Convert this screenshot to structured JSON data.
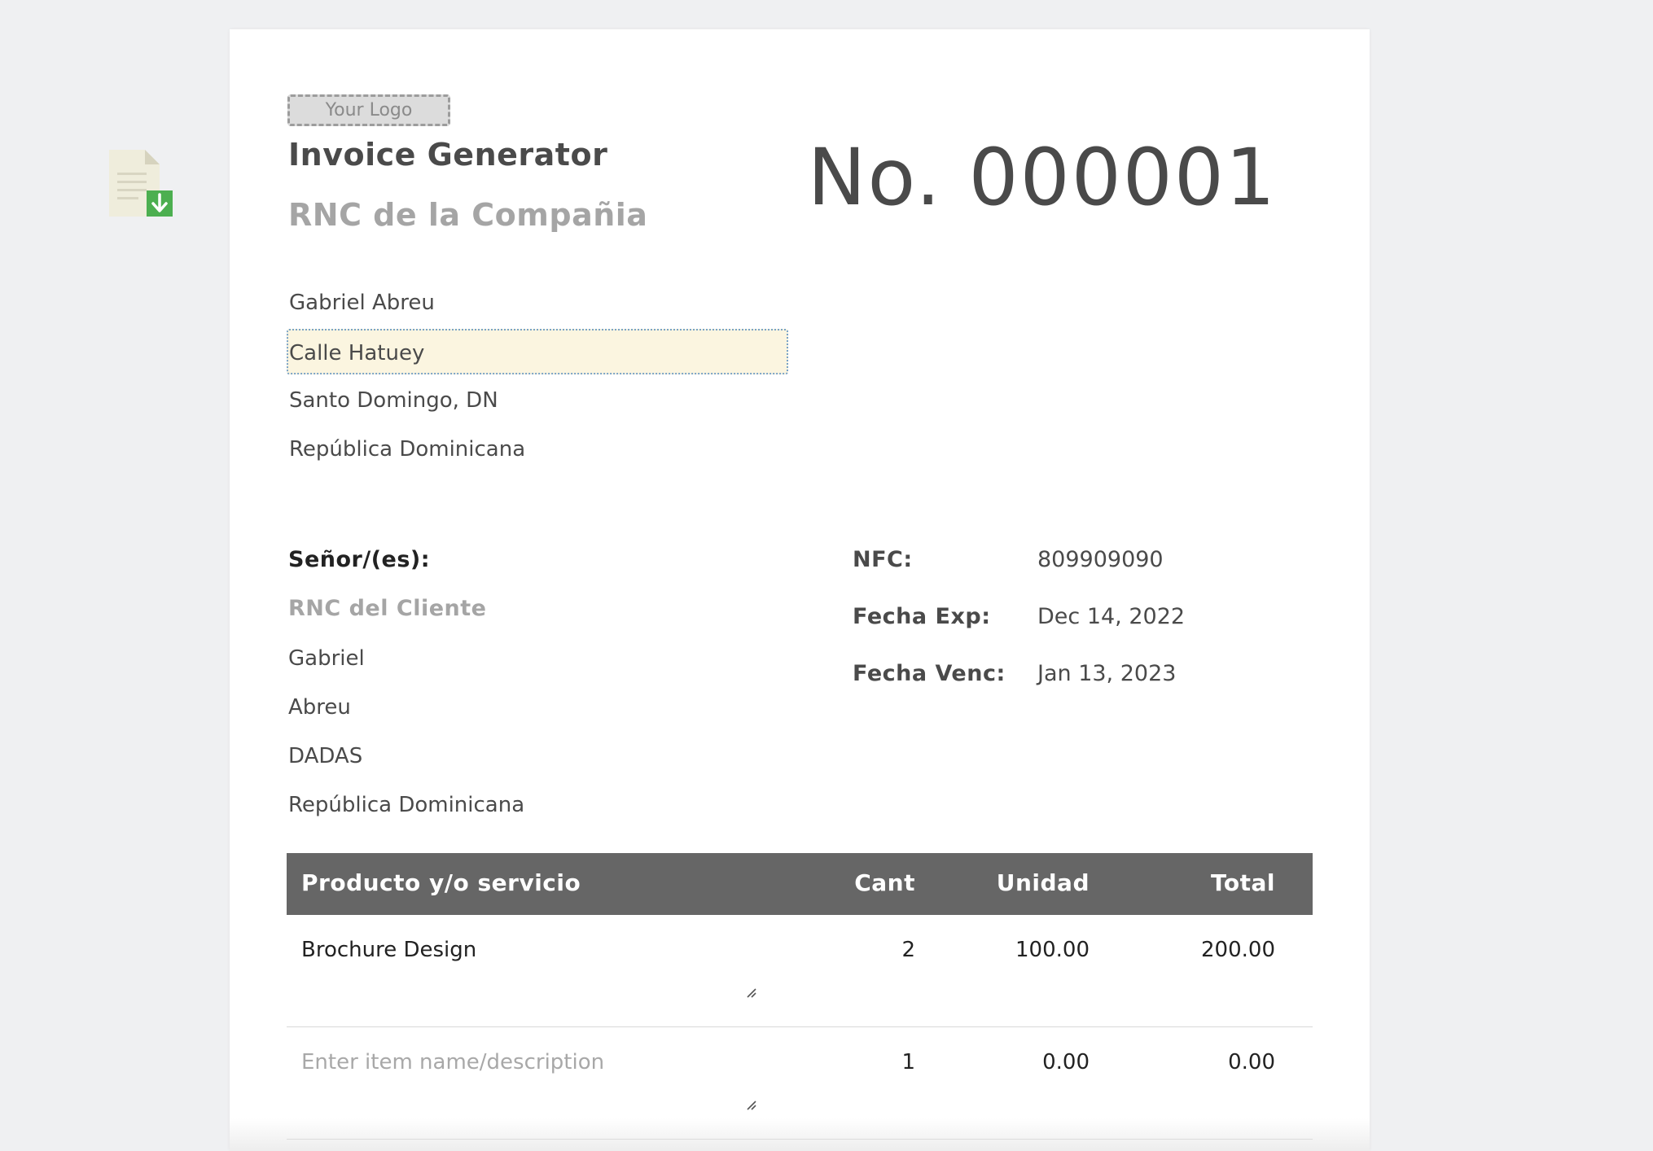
{
  "company": {
    "logo_placeholder": "Your Logo",
    "name": "Invoice Generator",
    "rnc": "RNC de la Compañia",
    "address_lines": [
      "Gabriel Abreu",
      "Calle Hatuey",
      "Santo Domingo, DN",
      "República Dominicana"
    ]
  },
  "invoice": {
    "number": "No. 000001"
  },
  "client": {
    "label": "Señor/(es):",
    "rnc": "RNC del Cliente",
    "lines": [
      "Gabriel",
      "Abreu",
      "DADAS",
      "República Dominicana"
    ]
  },
  "meta": [
    {
      "label": "NFC:",
      "value": "809909090"
    },
    {
      "label": "Fecha Exp:",
      "value": "Dec 14, 2022"
    },
    {
      "label": "Fecha Venc:",
      "value": "Jan 13, 2023"
    }
  ],
  "table": {
    "headers": {
      "product": "Producto y/o servicio",
      "qty": "Cant",
      "unit": "Unidad",
      "total": "Total"
    },
    "rows": [
      {
        "description": "Brochure Design",
        "qty": "2",
        "unit": "100.00",
        "total": "200.00"
      },
      {
        "description": "",
        "placeholder": "Enter item name/description",
        "qty": "1",
        "unit": "0.00",
        "total": "0.00"
      }
    ]
  },
  "icons": {
    "download": "file-download-icon",
    "resize": "textarea-resize-icon"
  }
}
